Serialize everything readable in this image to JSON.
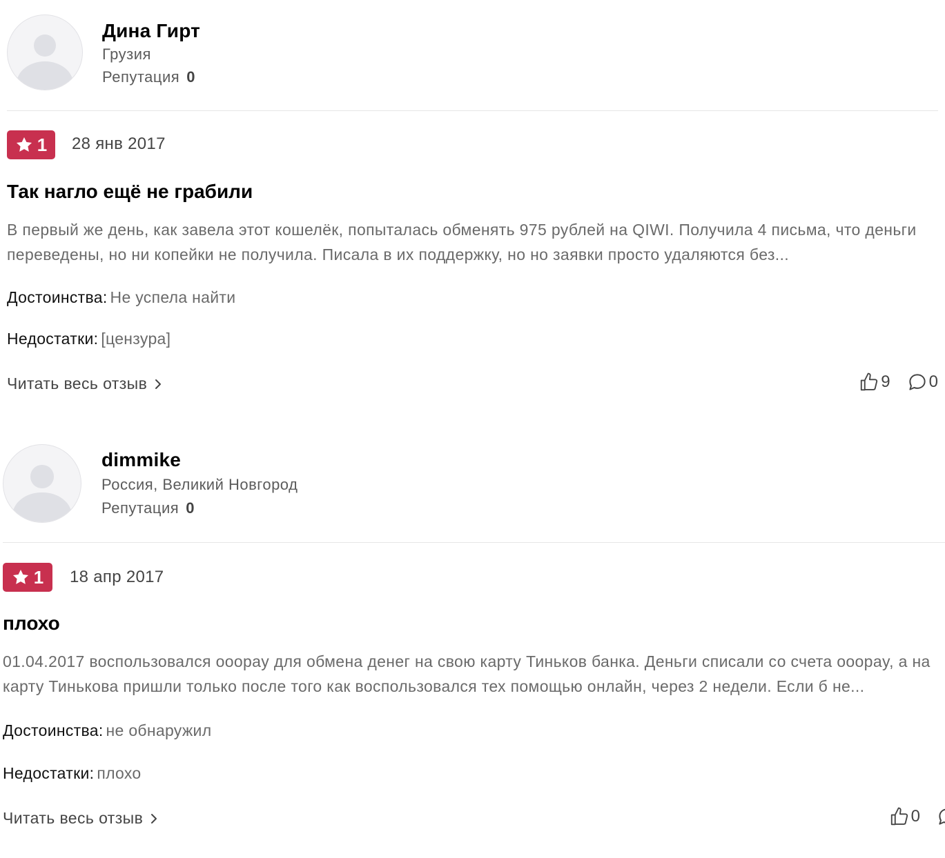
{
  "reviews": [
    {
      "author": {
        "name": "Дина Гирт",
        "location": "Грузия",
        "reputation_label": "Репутация",
        "reputation_value": "0"
      },
      "rating": "1",
      "date": "28 янв 2017",
      "title": "Так нагло ещё не грабили",
      "body": "В первый же день, как завела этот кошелёк, попыталась обменять 975 рублей на QIWI. Получила 4 письма, что деньги переведены, но ни копейки не получила. Писала в их поддержку, но но заявки просто удаляются без...",
      "pros_label": "Достоинства:",
      "pros": "Не успела найти",
      "cons_label": "Недостатки:",
      "cons": "[цензура]",
      "read_more": "Читать весь отзыв",
      "likes": "9",
      "comments": "0"
    },
    {
      "author": {
        "name": "dimmike",
        "location": "Россия, Великий Новгород",
        "reputation_label": "Репутация",
        "reputation_value": "0"
      },
      "rating": "1",
      "date": "18 апр 2017",
      "title": "плохо",
      "body": "01.04.2017 воспользовался ooopay для обмена денег на свою карту Тиньков банка. Деньги списали со счета ooopay, а на карту Тинькова пришли только после того как воспользовался тех помощью онлайн, через 2 недели. Если б не...",
      "pros_label": "Достоинства:",
      "pros": "не обнаружил",
      "cons_label": "Недостатки:",
      "cons": "плохо",
      "read_more": "Читать весь отзыв",
      "likes": "0",
      "comments": ""
    }
  ],
  "icons": {
    "rating": "star-icon",
    "read_more": "chevron-right-icon",
    "likes": "thumbs-up-icon",
    "comments": "comment-bubble-icon",
    "avatar": "user-avatar-icon"
  },
  "colors": {
    "rating_badge": "#c8304f",
    "text_primary": "#111111",
    "text_secondary": "#6a6a6a",
    "divider": "#e6e6e6"
  }
}
